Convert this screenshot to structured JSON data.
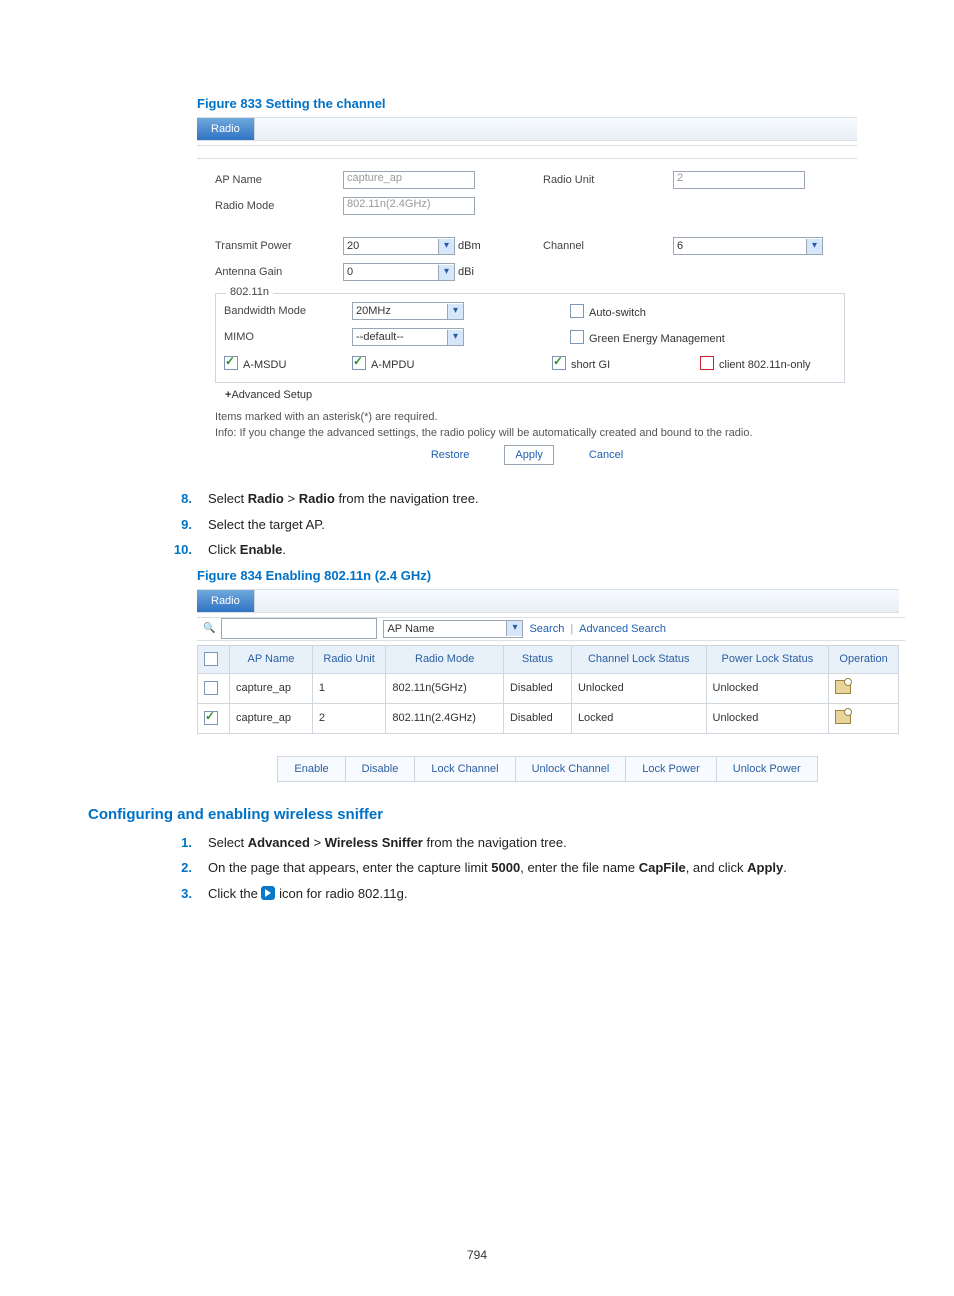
{
  "page_number": "794",
  "figures": {
    "f833": {
      "caption": "Figure 833 Setting the channel",
      "tab": "Radio",
      "fields": {
        "ap_name_label": "AP Name",
        "ap_name_value": "capture_ap",
        "radio_unit_label": "Radio Unit",
        "radio_unit_value": "2",
        "radio_mode_label": "Radio Mode",
        "radio_mode_value": "802.11n(2.4GHz)",
        "tx_power_label": "Transmit Power",
        "tx_power_value": "20",
        "tx_power_unit": "dBm",
        "channel_label": "Channel",
        "channel_value": "6",
        "antenna_gain_label": "Antenna Gain",
        "antenna_gain_value": "0",
        "antenna_gain_unit": "dBi"
      },
      "section_80211n": {
        "legend": "802.11n",
        "bandwidth_label": "Bandwidth Mode",
        "bandwidth_value": "20MHz",
        "autoswitch_label": "Auto-switch",
        "mimo_label": "MIMO",
        "mimo_value": "--default--",
        "green_energy_label": "Green Energy Management",
        "amsdu_label": "A-MSDU",
        "ampdu_label": "A-MPDU",
        "shortgi_label": "short GI",
        "client11n_label": "client 802.11n-only",
        "checks": {
          "amsdu": true,
          "ampdu": true,
          "shortgi": true,
          "autoswitch": false,
          "green": false,
          "client11n": false
        }
      },
      "advanced_setup": "Advanced Setup",
      "note1": "Items marked with an asterisk(*) are required.",
      "note2": "Info: If you change the advanced settings, the radio policy will be automatically created and bound to the radio.",
      "buttons": {
        "restore": "Restore",
        "apply": "Apply",
        "cancel": "Cancel"
      }
    },
    "f834": {
      "caption": "Figure 834 Enabling 802.11n (2.4 GHz)",
      "tab": "Radio",
      "search": {
        "field_option": "AP Name",
        "search_label": "Search",
        "advanced_label": "Advanced Search"
      },
      "columns": [
        "",
        "AP Name",
        "Radio Unit",
        "Radio Mode",
        "Status",
        "Channel Lock Status",
        "Power Lock Status",
        "Operation"
      ],
      "rows": [
        {
          "checked": false,
          "ap": "capture_ap",
          "unit": "1",
          "mode": "802.11n(5GHz)",
          "status": "Disabled",
          "chlock": "Unlocked",
          "pwlock": "Unlocked"
        },
        {
          "checked": true,
          "ap": "capture_ap",
          "unit": "2",
          "mode": "802.11n(2.4GHz)",
          "status": "Disabled",
          "chlock": "Locked",
          "pwlock": "Unlocked"
        }
      ],
      "buttons": [
        "Enable",
        "Disable",
        "Lock Channel",
        "Unlock Channel",
        "Lock Power",
        "Unlock Power"
      ]
    }
  },
  "steps_a": [
    {
      "n": "8.",
      "pre": "Select ",
      "b1": "Radio",
      "mid": " > ",
      "b2": "Radio",
      "post": " from the navigation tree."
    },
    {
      "n": "9.",
      "pre": "Select the target AP.",
      "b1": "",
      "mid": "",
      "b2": "",
      "post": ""
    },
    {
      "n": "10.",
      "pre": "Click ",
      "b1": "Enable",
      "mid": "",
      "b2": "",
      "post": "."
    }
  ],
  "heading_b": "Configuring and enabling wireless sniffer",
  "steps_b": [
    {
      "n": "1.",
      "pre": "Select ",
      "b1": "Advanced",
      "mid": " > ",
      "b2": "Wireless Sniffer",
      "post": " from the navigation tree."
    },
    {
      "n": "2.",
      "pre": "On the page that appears, enter the capture limit ",
      "b1": "5000",
      "mid": ", enter the file name ",
      "b2": "CapFile",
      "post": ", and click ",
      "b3": "Apply",
      "post2": "."
    },
    {
      "n": "3.",
      "pre": "Click the ",
      "icon": true,
      "post": " icon for radio 802.11g."
    }
  ]
}
